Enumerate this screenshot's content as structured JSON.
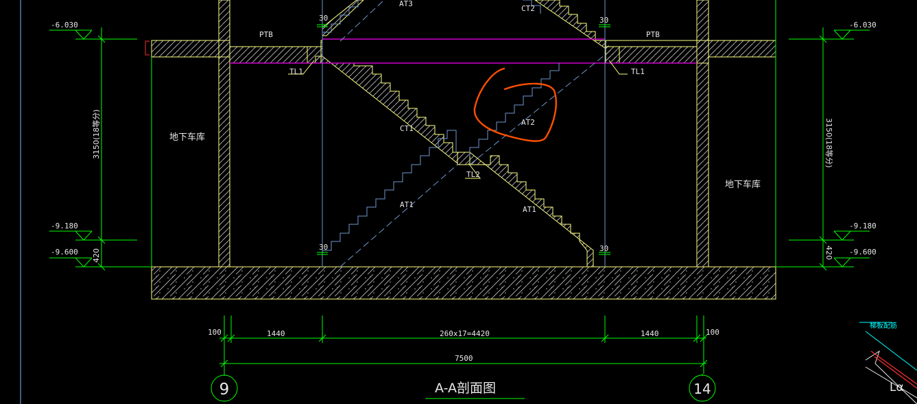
{
  "drawing_title": "A-A剖面图",
  "elevations": {
    "left": [
      "-6.030",
      "-9.180",
      "-9.600"
    ],
    "right": [
      "-6.030",
      "-9.180",
      "-9.600"
    ]
  },
  "vertical_dims": {
    "left_main": "3150(18等分)",
    "left_base": "420",
    "right_main": "3150(18等分)",
    "right_base": "420"
  },
  "rooms": {
    "left": "地下车库",
    "right": "地下车库"
  },
  "labels": {
    "at3": "AT3",
    "ct2": "CT2",
    "ptb_left": "PTB",
    "ptb_right": "PTB",
    "tl1_left": "TL1",
    "tl1_right": "TL1",
    "at2": "AT2",
    "ct1": "CT1",
    "tl2": "TL2",
    "at1_left": "AT1",
    "at1_right": "AT1",
    "gap_tl": "30",
    "gap_tr": "30",
    "gap_bl": "30",
    "gap_br": "30"
  },
  "horizontal_dims": {
    "off_left": "100",
    "seg1": "1440",
    "seg2": "260x17=4420",
    "seg3": "1440",
    "off_right": "100",
    "total": "7500"
  },
  "axes": {
    "left": "9",
    "right": "14"
  },
  "corner_note": "梯板配筋",
  "corner_mark": "Lα",
  "colors": {
    "background": "#000000",
    "dimension": "#00ff00",
    "structure": "#ffff80",
    "stair": "#6f98d0",
    "platform": "#d000d0",
    "markup": "#ff5000",
    "text": "#e8e8e8",
    "note": "#00ffff",
    "rebar": "#ff3030"
  }
}
